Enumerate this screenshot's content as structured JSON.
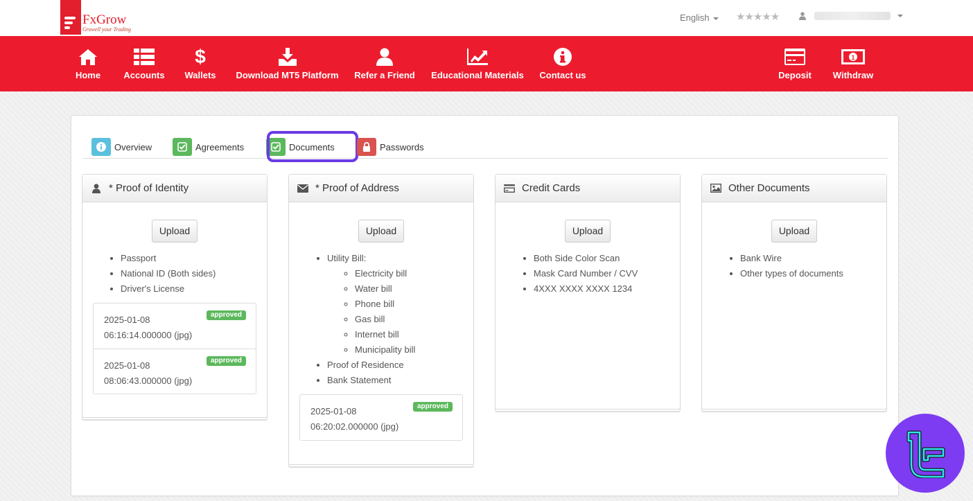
{
  "brand": {
    "name": "FxGrow",
    "tagline": "Growell your Trading"
  },
  "topbar": {
    "language": "English",
    "stars": "★★★★★"
  },
  "nav": {
    "items": [
      {
        "label": "Home",
        "icon": "home-icon"
      },
      {
        "label": "Accounts",
        "icon": "list-icon"
      },
      {
        "label": "Wallets",
        "icon": "dollar-icon"
      },
      {
        "label": "Download MT5 Platform",
        "icon": "download-icon"
      },
      {
        "label": "Refer a Friend",
        "icon": "user-icon"
      },
      {
        "label": "Educational Materials",
        "icon": "chart-icon"
      },
      {
        "label": "Contact us",
        "icon": "info-icon"
      },
      {
        "label": "Deposit",
        "icon": "credit-card-icon"
      },
      {
        "label": "Withdraw",
        "icon": "money-icon"
      }
    ]
  },
  "tabs": [
    {
      "label": "Overview",
      "color": "#5bc0de"
    },
    {
      "label": "Agreements",
      "color": "#5cb85c"
    },
    {
      "label": "Documents",
      "color": "#5cb85c"
    },
    {
      "label": "Passwords",
      "color": "#d9534f"
    }
  ],
  "cards": {
    "identity": {
      "title": "* Proof of Identity",
      "upload": "Upload",
      "items": [
        "Passport",
        "National ID (Both sides)",
        "Driver's License"
      ],
      "files": [
        {
          "date": "2025-01-08",
          "time": "06:16:14.000000 (jpg)",
          "status": "approved"
        },
        {
          "date": "2025-01-08",
          "time": "08:06:43.000000 (jpg)",
          "status": "approved"
        }
      ]
    },
    "address": {
      "title": "* Proof of Address",
      "upload": "Upload",
      "utility": "Utility Bill:",
      "utility_items": [
        "Electricity bill",
        "Water bill",
        "Phone bill",
        "Gas bill",
        "Internet bill",
        "Municipality bill"
      ],
      "other_items": [
        "Proof of Residence",
        "Bank Statement"
      ],
      "files": [
        {
          "date": "2025-01-08",
          "time": "06:20:02.000000 (jpg)",
          "status": "approved"
        }
      ]
    },
    "credit": {
      "title": "Credit Cards",
      "upload": "Upload",
      "items": [
        "Both Side Color Scan",
        "Mask Card Number / CVV",
        "4XXX XXXX XXXX 1234"
      ]
    },
    "other": {
      "title": "Other Documents",
      "upload": "Upload",
      "items": [
        "Bank Wire",
        "Other types of documents"
      ]
    }
  },
  "colors": {
    "nav_red": "#ec1c2e",
    "highlight": "#6a3be4",
    "approved_green": "#5cb85c"
  }
}
